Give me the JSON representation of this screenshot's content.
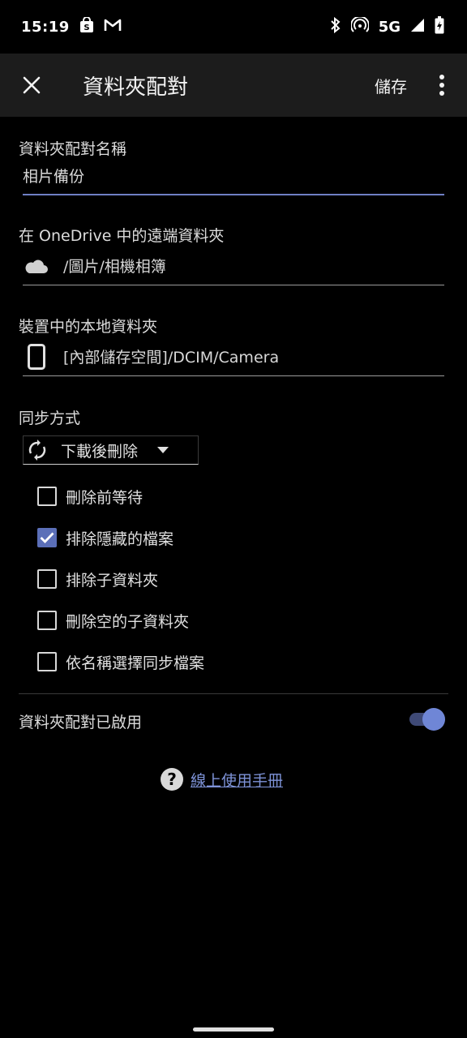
{
  "status_bar": {
    "time": "15:19",
    "network": "5G",
    "icons": [
      "shopping-bag-icon",
      "gmail-icon",
      "bluetooth-icon",
      "hotspot-icon",
      "signal-icon",
      "battery-icon"
    ]
  },
  "app_bar": {
    "title": "資料夾配對",
    "save_label": "儲存",
    "close_icon": "close-icon",
    "more_icon": "more-vert-icon"
  },
  "form": {
    "pair_name_label": "資料夾配對名稱",
    "pair_name_value": "相片備份",
    "remote_label": "在 OneDrive 中的遠端資料夾",
    "remote_value": "/圖片/相機相簿",
    "local_label": "裝置中的本地資料夾",
    "local_value": "[內部儲存空間]/DCIM/Camera",
    "sync_method_label": "同步方式",
    "sync_method_value": "下載後刪除",
    "options": [
      {
        "label": "刪除前等待",
        "checked": false
      },
      {
        "label": "排除隱藏的檔案",
        "checked": true
      },
      {
        "label": "排除子資料夾",
        "checked": false
      },
      {
        "label": "刪除空的子資料夾",
        "checked": false
      },
      {
        "label": "依名稱選擇同步檔案",
        "checked": false
      }
    ],
    "enabled_label": "資料夾配對已啟用",
    "enabled": true
  },
  "help": {
    "link_label": "線上使用手冊",
    "icon_glyph": "?"
  },
  "colors": {
    "accent": "#6f86d6",
    "checkbox_checked": "#5b6fb8",
    "link": "#7e93d8",
    "app_bar_bg": "#1c1c1c"
  }
}
